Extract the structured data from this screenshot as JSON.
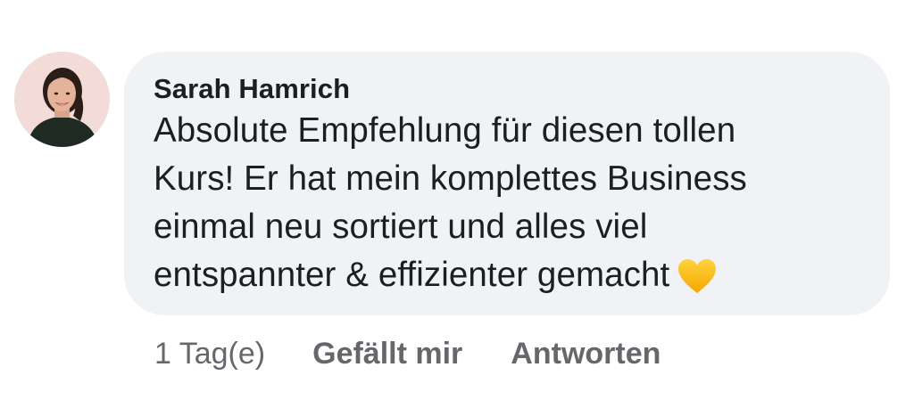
{
  "comment": {
    "author": "Sarah Hamrich",
    "text_lines": [
      "Absolute Empfehlung für diesen tollen",
      "Kurs! Er hat mein komplettes Business",
      "einmal neu sortiert und alles viel",
      "entspannter & effizienter gemacht"
    ],
    "emoji": "yellow-heart-icon",
    "bubble_color": "#f0f2f5",
    "text_color": "#1c1e21"
  },
  "actions": {
    "time": "1 Tag(e)",
    "like_label": "Gefällt mir",
    "reply_label": "Antworten",
    "color": "#65676b"
  }
}
